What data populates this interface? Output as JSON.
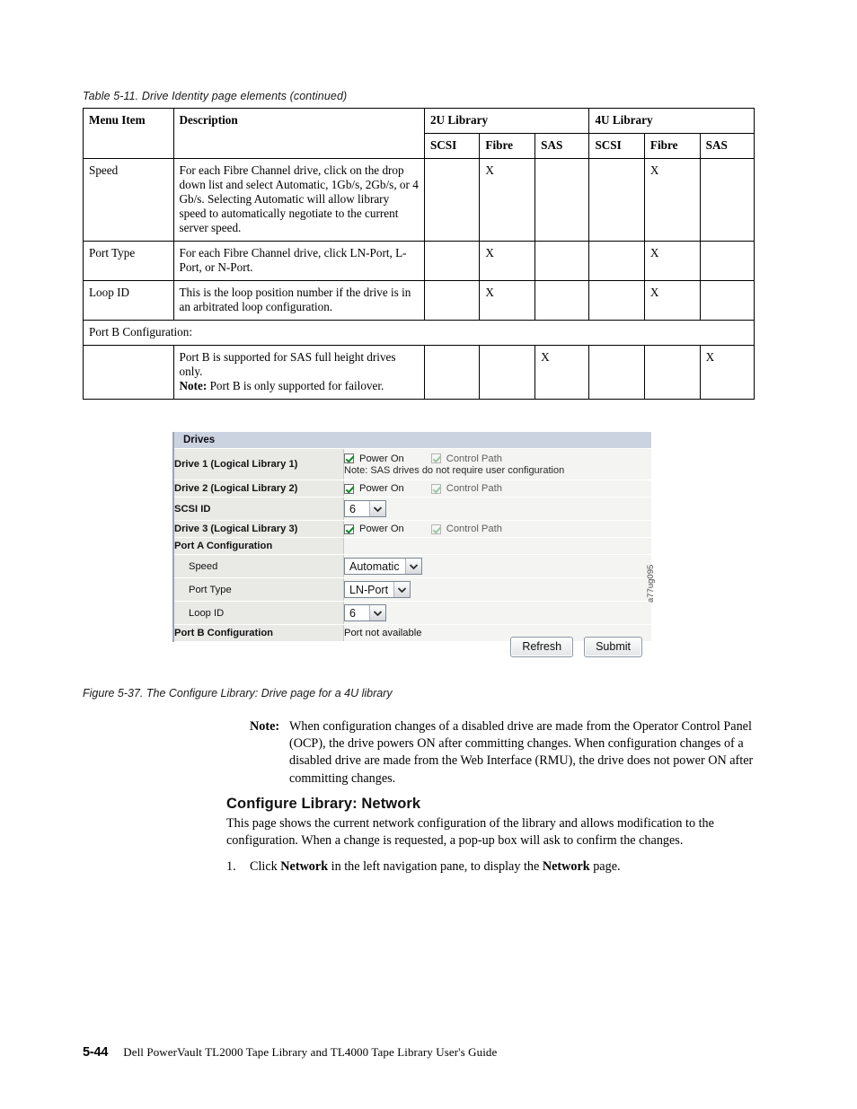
{
  "table": {
    "caption": "Table 5-11. Drive Identity page elements  (continued)",
    "headers": {
      "menu_item": "Menu Item",
      "description": "Description",
      "group_2u": "2U Library",
      "group_4u": "4U Library",
      "sub": [
        "SCSI",
        "Fibre",
        "SAS",
        "SCSI",
        "Fibre",
        "SAS"
      ]
    },
    "rows": [
      {
        "menu_item": "Speed",
        "description": "For each Fibre Channel drive, click on the drop down list and select Automatic, 1Gb/s, 2Gb/s, or 4 Gb/s. Selecting Automatic will allow library speed to automatically negotiate to the current server speed.",
        "marks": [
          "",
          "X",
          "",
          "",
          "X",
          ""
        ]
      },
      {
        "menu_item": "Port Type",
        "description": "For each Fibre Channel drive, click LN-Port, L-Port, or N-Port.",
        "marks": [
          "",
          "X",
          "",
          "",
          "X",
          ""
        ]
      },
      {
        "menu_item": "Loop ID",
        "description": "This is the loop position number if the drive is in an arbitrated loop configuration.",
        "marks": [
          "",
          "X",
          "",
          "",
          "X",
          ""
        ]
      }
    ],
    "span_row": "Port B Configuration:",
    "last_row": {
      "menu_item": "",
      "description_line1": "Port B is supported for SAS full height drives",
      "description_line2": "only.",
      "note_label": "Note:",
      "note_text": "Port B is only supported for failover.",
      "marks": [
        "",
        "",
        "X",
        "",
        "",
        "X"
      ]
    }
  },
  "figure": {
    "panel_title": "Drives",
    "rows": [
      {
        "label": "Drive 1 (Logical Library 1)",
        "power_on": "Power On",
        "control_path": "Control Path",
        "note": "Note: SAS drives do not require user configuration"
      },
      {
        "label": "Drive 2 (Logical Library 2)",
        "power_on": "Power On",
        "control_path": "Control Path"
      },
      {
        "label": "SCSI ID",
        "select_value": "6"
      },
      {
        "label": "Drive 3 (Logical Library 3)",
        "power_on": "Power On",
        "control_path": "Control Path"
      },
      {
        "label": "Port A Configuration",
        "value": ""
      },
      {
        "label": "Speed",
        "select_value": "Automatic"
      },
      {
        "label": "Port Type",
        "select_value": "LN-Port"
      },
      {
        "label": "Loop ID",
        "select_value": "6"
      },
      {
        "label": "Port B Configuration",
        "value": "Port not available"
      }
    ],
    "buttons": {
      "refresh": "Refresh",
      "submit": "Submit"
    },
    "figure_id": "a77ug095",
    "caption": "Figure 5-37. The Configure Library: Drive page for a 4U library"
  },
  "note": {
    "label": "Note:",
    "text": "When configuration changes of a disabled drive are made from the Operator Control Panel (OCP), the drive powers ON after committing changes. When configuration changes of a disabled drive are made from the Web Interface (RMU), the drive does not power ON after committing changes."
  },
  "section": {
    "heading": "Configure Library: Network",
    "body": "This page shows the current network configuration of the library and allows modification to the configuration. When a change is requested, a pop-up box will ask to confirm the changes.",
    "step_number": "1.",
    "step_pre": "Click ",
    "step_bold1": "Network",
    "step_mid": " in the left navigation pane, to display the ",
    "step_bold2": "Network",
    "step_post": " page."
  },
  "footer": {
    "page_number": "5-44",
    "text": "Dell PowerVault TL2000 Tape Library and TL4000 Tape Library User's Guide"
  }
}
